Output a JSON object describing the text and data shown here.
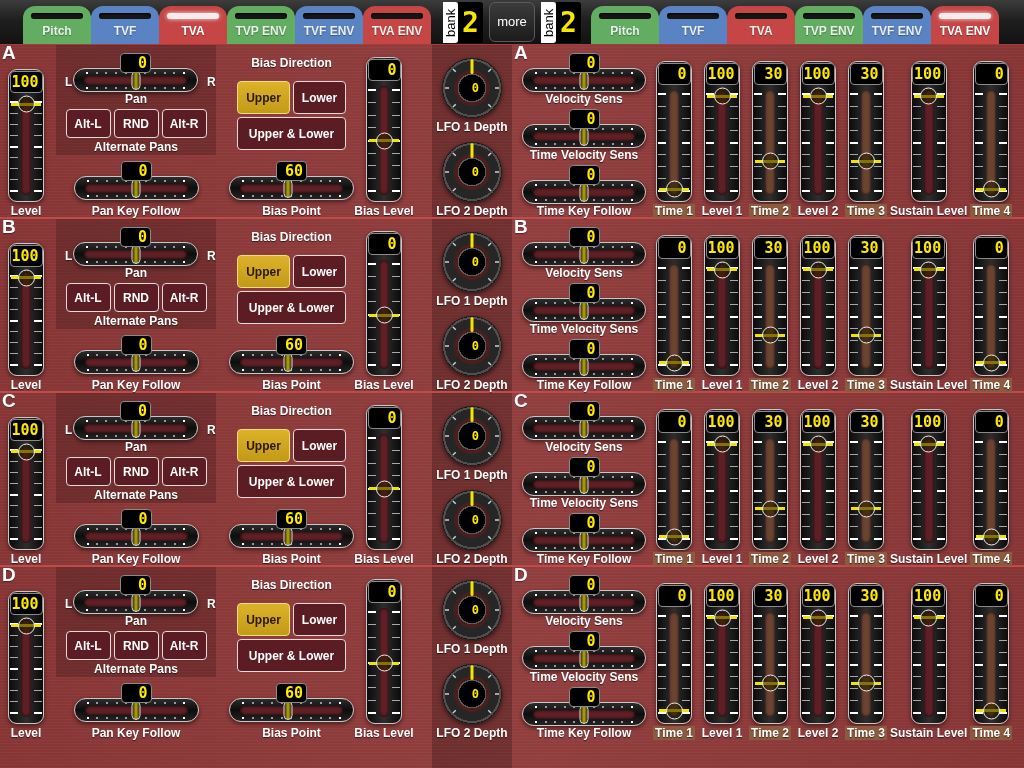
{
  "top_bar": {
    "left_tabs": [
      {
        "label": "Pitch",
        "color": "#62ad62",
        "selected": false
      },
      {
        "label": "TVF",
        "color": "#5a83c4",
        "selected": false
      },
      {
        "label": "TVA",
        "color": "#c64646",
        "selected": true
      },
      {
        "label": "TVP ENV",
        "color": "#62ad62",
        "selected": false
      },
      {
        "label": "TVF ENV",
        "color": "#5a83c4",
        "selected": false
      },
      {
        "label": "TVA ENV",
        "color": "#c64646",
        "selected": false
      }
    ],
    "left_bank": {
      "label": "bank",
      "value": "2"
    },
    "more_button": "more",
    "right_bank": {
      "label": "bank",
      "value": "2"
    },
    "right_tabs": [
      {
        "label": "Pitch",
        "color": "#62ad62",
        "selected": false
      },
      {
        "label": "TVF",
        "color": "#5a83c4",
        "selected": false
      },
      {
        "label": "TVA",
        "color": "#c64646",
        "selected": false
      },
      {
        "label": "TVP ENV",
        "color": "#62ad62",
        "selected": false
      },
      {
        "label": "TVF ENV",
        "color": "#5a83c4",
        "selected": false
      },
      {
        "label": "TVA ENV",
        "color": "#c64646",
        "selected": true
      }
    ]
  },
  "tone_sections": [
    {
      "letter": "A",
      "level": {
        "label": "Level",
        "reading": "100",
        "level": 1
      },
      "pan": {
        "label": "Pan",
        "reading": "0",
        "level": 0.5,
        "left": "L",
        "right": "R"
      },
      "alternate_pans": {
        "label": "Alternate Pans",
        "buttons": [
          "Alt-L",
          "RND",
          "Alt-R"
        ]
      },
      "pan_key_follow": {
        "label": "Pan Key Follow",
        "reading": "0",
        "level": 0.5
      },
      "bias_direction": {
        "label": "Bias Direction",
        "options": [
          {
            "label": "Upper",
            "selected": true
          },
          {
            "label": "Lower",
            "selected": false
          },
          {
            "label": "Upper & Lower",
            "selected": false
          }
        ]
      },
      "bias_point": {
        "label": "Bias Point",
        "reading": "60",
        "level": 0.46
      },
      "bias_level": {
        "label": "Bias Level",
        "reading": "0",
        "level": 0.5
      },
      "lfo_depths": [
        {
          "label": "LFO 1 Depth",
          "reading": "0",
          "level": 0.5
        },
        {
          "label": "LFO 2 Depth",
          "reading": "0",
          "level": 0.5
        }
      ]
    },
    {
      "letter": "B",
      "level": {
        "label": "Level",
        "reading": "100",
        "level": 1
      },
      "pan": {
        "label": "Pan",
        "reading": "0",
        "level": 0.5,
        "left": "L",
        "right": "R"
      },
      "alternate_pans": {
        "label": "Alternate Pans",
        "buttons": [
          "Alt-L",
          "RND",
          "Alt-R"
        ]
      },
      "pan_key_follow": {
        "label": "Pan Key Follow",
        "reading": "0",
        "level": 0.5
      },
      "bias_direction": {
        "label": "Bias Direction",
        "options": [
          {
            "label": "Upper",
            "selected": true
          },
          {
            "label": "Lower",
            "selected": false
          },
          {
            "label": "Upper & Lower",
            "selected": false
          }
        ]
      },
      "bias_point": {
        "label": "Bias Point",
        "reading": "60",
        "level": 0.46
      },
      "bias_level": {
        "label": "Bias Level",
        "reading": "0",
        "level": 0.5
      },
      "lfo_depths": [
        {
          "label": "LFO 1 Depth",
          "reading": "0",
          "level": 0.5
        },
        {
          "label": "LFO 2 Depth",
          "reading": "0",
          "level": 0.5
        }
      ]
    },
    {
      "letter": "C",
      "level": {
        "label": "Level",
        "reading": "100",
        "level": 1
      },
      "pan": {
        "label": "Pan",
        "reading": "0",
        "level": 0.5,
        "left": "L",
        "right": "R"
      },
      "alternate_pans": {
        "label": "Alternate Pans",
        "buttons": [
          "Alt-L",
          "RND",
          "Alt-R"
        ]
      },
      "pan_key_follow": {
        "label": "Pan Key Follow",
        "reading": "0",
        "level": 0.5
      },
      "bias_direction": {
        "label": "Bias Direction",
        "options": [
          {
            "label": "Upper",
            "selected": true
          },
          {
            "label": "Lower",
            "selected": false
          },
          {
            "label": "Upper & Lower",
            "selected": false
          }
        ]
      },
      "bias_point": {
        "label": "Bias Point",
        "reading": "60",
        "level": 0.46
      },
      "bias_level": {
        "label": "Bias Level",
        "reading": "0",
        "level": 0.5
      },
      "lfo_depths": [
        {
          "label": "LFO 1 Depth",
          "reading": "0",
          "level": 0.5
        },
        {
          "label": "LFO 2 Depth",
          "reading": "0",
          "level": 0.5
        }
      ]
    },
    {
      "letter": "D",
      "level": {
        "label": "Level",
        "reading": "100",
        "level": 1
      },
      "pan": {
        "label": "Pan",
        "reading": "0",
        "level": 0.5,
        "left": "L",
        "right": "R"
      },
      "alternate_pans": {
        "label": "Alternate Pans",
        "buttons": [
          "Alt-L",
          "RND",
          "Alt-R"
        ]
      },
      "pan_key_follow": {
        "label": "Pan Key Follow",
        "reading": "0",
        "level": 0.5
      },
      "bias_direction": {
        "label": "Bias Direction",
        "options": [
          {
            "label": "Upper",
            "selected": true
          },
          {
            "label": "Lower",
            "selected": false
          },
          {
            "label": "Upper & Lower",
            "selected": false
          }
        ]
      },
      "bias_point": {
        "label": "Bias Point",
        "reading": "60",
        "level": 0.46
      },
      "bias_level": {
        "label": "Bias Level",
        "reading": "0",
        "level": 0.5
      },
      "lfo_depths": [
        {
          "label": "LFO 1 Depth",
          "reading": "0",
          "level": 0.5
        },
        {
          "label": "LFO 2 Depth",
          "reading": "0",
          "level": 0.5
        }
      ]
    }
  ],
  "envelope_sections": [
    {
      "letter": "A",
      "sens_sliders": [
        {
          "label": "Velocity Sens",
          "reading": "0",
          "level": 0.5
        },
        {
          "label": "Time Velocity Sens",
          "reading": "0",
          "level": 0.5
        },
        {
          "label": "Time Key Follow",
          "reading": "0",
          "level": 0.5
        }
      ],
      "sliders": [
        {
          "kind": "time",
          "label": "Time 1",
          "reading": "0",
          "level": 0
        },
        {
          "kind": "level",
          "label": "Level 1",
          "reading": "100",
          "level": 1
        },
        {
          "kind": "time",
          "label": "Time 2",
          "reading": "30",
          "level": 0.3
        },
        {
          "kind": "level",
          "label": "Level 2",
          "reading": "100",
          "level": 1
        },
        {
          "kind": "time",
          "label": "Time 3",
          "reading": "30",
          "level": 0.3
        },
        {
          "kind": "level",
          "label": "Sustain Level",
          "reading": "100",
          "level": 1
        },
        {
          "kind": "time",
          "label": "Time 4",
          "reading": "0",
          "level": 0
        }
      ]
    },
    {
      "letter": "B",
      "sens_sliders": [
        {
          "label": "Velocity Sens",
          "reading": "0",
          "level": 0.5
        },
        {
          "label": "Time Velocity Sens",
          "reading": "0",
          "level": 0.5
        },
        {
          "label": "Time Key Follow",
          "reading": "0",
          "level": 0.5
        }
      ],
      "sliders": [
        {
          "kind": "time",
          "label": "Time 1",
          "reading": "0",
          "level": 0
        },
        {
          "kind": "level",
          "label": "Level 1",
          "reading": "100",
          "level": 1
        },
        {
          "kind": "time",
          "label": "Time 2",
          "reading": "30",
          "level": 0.3
        },
        {
          "kind": "level",
          "label": "Level 2",
          "reading": "100",
          "level": 1
        },
        {
          "kind": "time",
          "label": "Time 3",
          "reading": "30",
          "level": 0.3
        },
        {
          "kind": "level",
          "label": "Sustain Level",
          "reading": "100",
          "level": 1
        },
        {
          "kind": "time",
          "label": "Time 4",
          "reading": "0",
          "level": 0
        }
      ]
    },
    {
      "letter": "C",
      "sens_sliders": [
        {
          "label": "Velocity Sens",
          "reading": "0",
          "level": 0.5
        },
        {
          "label": "Time Velocity Sens",
          "reading": "0",
          "level": 0.5
        },
        {
          "label": "Time Key Follow",
          "reading": "0",
          "level": 0.5
        }
      ],
      "sliders": [
        {
          "kind": "time",
          "label": "Time 1",
          "reading": "0",
          "level": 0
        },
        {
          "kind": "level",
          "label": "Level 1",
          "reading": "100",
          "level": 1
        },
        {
          "kind": "time",
          "label": "Time 2",
          "reading": "30",
          "level": 0.3
        },
        {
          "kind": "level",
          "label": "Level 2",
          "reading": "100",
          "level": 1
        },
        {
          "kind": "time",
          "label": "Time 3",
          "reading": "30",
          "level": 0.3
        },
        {
          "kind": "level",
          "label": "Sustain Level",
          "reading": "100",
          "level": 1
        },
        {
          "kind": "time",
          "label": "Time 4",
          "reading": "0",
          "level": 0
        }
      ]
    },
    {
      "letter": "D",
      "sens_sliders": [
        {
          "label": "Velocity Sens",
          "reading": "0",
          "level": 0.5
        },
        {
          "label": "Time Velocity Sens",
          "reading": "0",
          "level": 0.5
        },
        {
          "label": "Time Key Follow",
          "reading": "0",
          "level": 0.5
        }
      ],
      "sliders": [
        {
          "kind": "time",
          "label": "Time 1",
          "reading": "0",
          "level": 0
        },
        {
          "kind": "level",
          "label": "Level 1",
          "reading": "100",
          "level": 1
        },
        {
          "kind": "time",
          "label": "Time 2",
          "reading": "30",
          "level": 0.3
        },
        {
          "kind": "level",
          "label": "Level 2",
          "reading": "100",
          "level": 1
        },
        {
          "kind": "time",
          "label": "Time 3",
          "reading": "30",
          "level": 0.3
        },
        {
          "kind": "level",
          "label": "Sustain Level",
          "reading": "100",
          "level": 1
        },
        {
          "kind": "time",
          "label": "Time 4",
          "reading": "0",
          "level": 0
        }
      ]
    }
  ]
}
